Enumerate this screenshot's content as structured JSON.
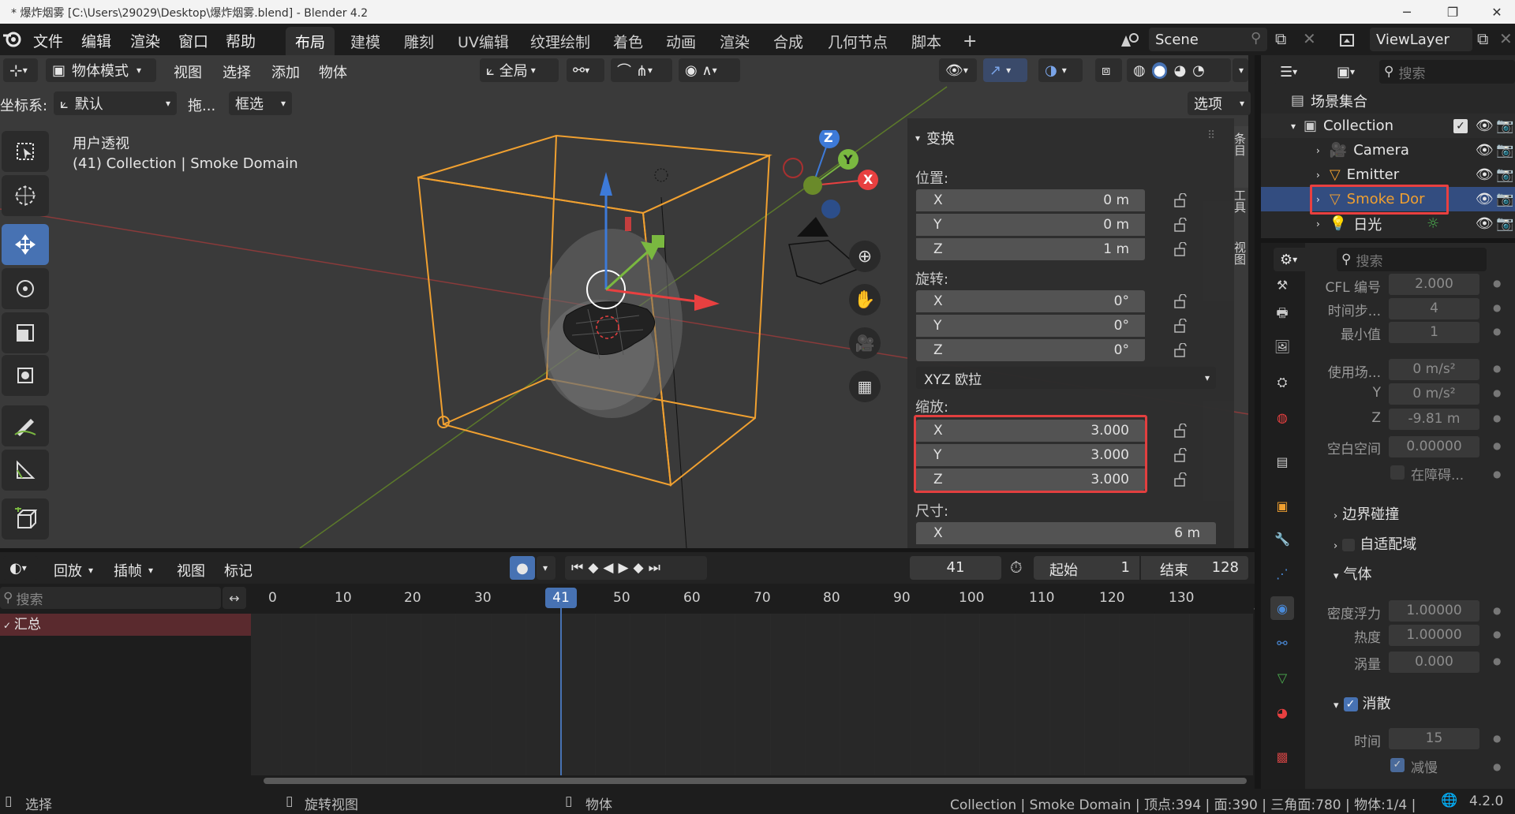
{
  "window": {
    "title": "* 爆炸烟雾 [C:\\Users\\29029\\Desktop\\爆炸烟雾.blend] - Blender 4.2"
  },
  "menu": {
    "file": "文件",
    "edit": "编辑",
    "render": "渲染",
    "window": "窗口",
    "help": "帮助"
  },
  "workspaces": [
    "布局",
    "建模",
    "雕刻",
    "UV编辑",
    "纹理绘制",
    "着色",
    "动画",
    "渲染",
    "合成",
    "几何节点",
    "脚本"
  ],
  "scene": {
    "name": "Scene",
    "view_layer": "ViewLayer"
  },
  "viewport_header": {
    "mode": "物体模式",
    "view": "视图",
    "select": "选择",
    "add": "添加",
    "object": "物体",
    "orientation": "全局"
  },
  "viewport_sub": {
    "coord_label": "坐标系:",
    "coord_value": "默认",
    "drag_label": "拖...",
    "select_mode": "框选",
    "options": "选项"
  },
  "viewport": {
    "view_name": "用户透视",
    "context": "(41) Collection | Smoke Domain"
  },
  "gizmo": {
    "x": "X",
    "y": "Y",
    "z": "Z"
  },
  "side_tabs": [
    "条目",
    "工具",
    "视图"
  ],
  "transform": {
    "header": "变换",
    "location_label": "位置:",
    "location": [
      {
        "axis": "X",
        "value": "0 m"
      },
      {
        "axis": "Y",
        "value": "0 m"
      },
      {
        "axis": "Z",
        "value": "1 m"
      }
    ],
    "rotation_label": "旋转:",
    "rotation": [
      {
        "axis": "X",
        "value": "0°"
      },
      {
        "axis": "Y",
        "value": "0°"
      },
      {
        "axis": "Z",
        "value": "0°"
      }
    ],
    "rotation_mode": "XYZ 欧拉",
    "scale_label": "缩放:",
    "scale": [
      {
        "axis": "X",
        "value": "3.000"
      },
      {
        "axis": "Y",
        "value": "3.000"
      },
      {
        "axis": "Z",
        "value": "3.000"
      }
    ],
    "dimensions_label": "尺寸:",
    "dimensions": [
      {
        "axis": "X",
        "value": "6 m"
      }
    ]
  },
  "timeline_header": {
    "playback": "回放",
    "keying": "插帧",
    "view": "视图",
    "marker": "标记",
    "current_frame": "41",
    "start_label": "起始",
    "start": "1",
    "end_label": "结束",
    "end": "128"
  },
  "timeline": {
    "search_placeholder": "搜索",
    "summary": "汇总",
    "ticks": [
      "0",
      "10",
      "20",
      "30",
      "50",
      "60",
      "70",
      "80",
      "90",
      "100",
      "110",
      "120",
      "130"
    ],
    "playhead": "41"
  },
  "outliner": {
    "search_placeholder": "搜索",
    "root": "场景集合",
    "collection": "Collection",
    "items": [
      "Camera",
      "Emitter",
      "Smoke Dor",
      "日光"
    ]
  },
  "properties": {
    "search_placeholder": "搜索",
    "fields": [
      {
        "label": "CFL 编号",
        "value": "2.000"
      },
      {
        "label": "时间步...",
        "value": "4"
      },
      {
        "label": "最小值",
        "value": "1"
      },
      {
        "label": "使用场...",
        "value": "0 m/s²"
      },
      {
        "label": "Y",
        "value": "0 m/s²"
      },
      {
        "label": "Z",
        "value": "-9.81 m"
      },
      {
        "label": "空白空间",
        "value": "0.00000"
      }
    ],
    "obstacle_check": "在障碍...",
    "border_collision": "边界碰撞",
    "adaptive_domain": "自适配域",
    "gas": "气体",
    "gas_fields": [
      {
        "label": "密度浮力",
        "value": "1.00000"
      },
      {
        "label": "热度",
        "value": "1.00000"
      },
      {
        "label": "涡量",
        "value": "0.000"
      }
    ],
    "dissolve": "消散",
    "dissolve_time_label": "时间",
    "dissolve_time": "15",
    "slow": "减慢"
  },
  "statusbar": {
    "select": "选择",
    "rotate_view": "旋转视图",
    "object": "物体",
    "info": "Collection | Smoke Domain | 顶点:394 | 面:390 | 三角面:780 | 物体:1/4 |",
    "version": "4.2.0"
  },
  "colors": {
    "accent": "#4772b3",
    "highlight": "#e84040",
    "selection_orange": "#f0a030",
    "playhead": "#4772b3"
  }
}
